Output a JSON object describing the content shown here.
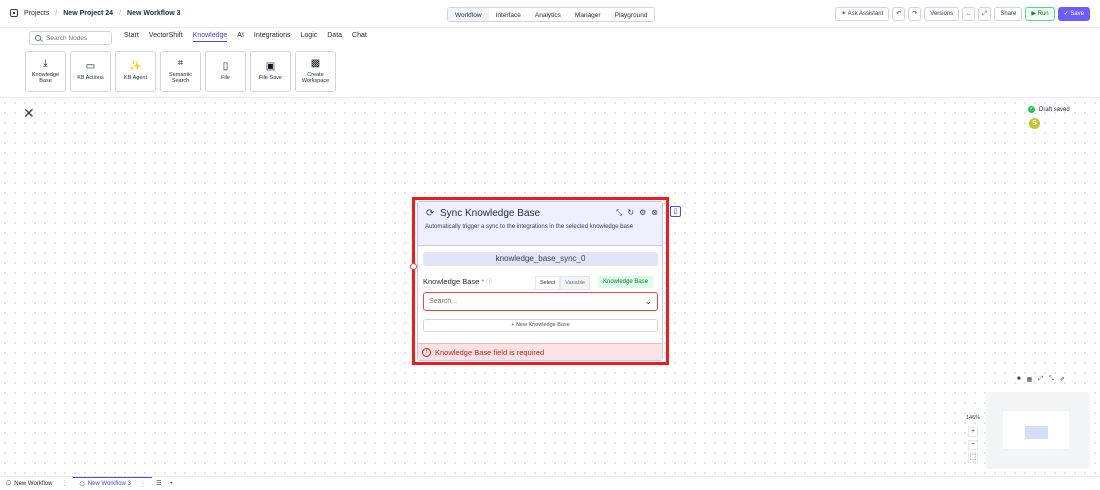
{
  "topbar": {
    "breadcrumbs": [
      "Projects",
      "New Project 24",
      "New Workflow 3"
    ],
    "tabs": [
      {
        "label": "Workflow",
        "active": true
      },
      {
        "label": "Interface",
        "active": false
      },
      {
        "label": "Analytics",
        "active": false
      },
      {
        "label": "Manager",
        "active": false
      },
      {
        "label": "Playground",
        "active": false
      }
    ],
    "ask_assistant": "✶ Ask Assistant",
    "undo": "↶",
    "redo": "↷",
    "versions": "Versions",
    "split": "↔",
    "expand": "⤢",
    "share": "Share",
    "run": "▶ Run",
    "save": "✓ Save"
  },
  "toolbar": {
    "search_placeholder": "Search Nodes",
    "categories": [
      "Start",
      "VectorShift",
      "Knowledge",
      "AI",
      "Integrations",
      "Logic",
      "Data",
      "Chat"
    ],
    "active_category": "Knowledge",
    "nodes": [
      {
        "label": "Knowledge Base",
        "icon": "download-icon",
        "glyph": "⤓"
      },
      {
        "label": "KB Actions",
        "icon": "folder-icon",
        "glyph": "▭"
      },
      {
        "label": "KB Agent",
        "icon": "magic-wand-icon",
        "glyph": "✨"
      },
      {
        "label": "Semantic Search",
        "icon": "crop-icon",
        "glyph": "⌗"
      },
      {
        "label": "File",
        "icon": "file-icon",
        "glyph": "▯"
      },
      {
        "label": "File Save",
        "icon": "floppy-icon",
        "glyph": "▣"
      },
      {
        "label": "Create Workspace",
        "icon": "folder-plus-icon",
        "glyph": "▩"
      }
    ]
  },
  "canvas": {
    "close": "✕",
    "draft_status": "Draft saved",
    "avatar_initial": "S",
    "zoom": "146%",
    "zoom_in": "+",
    "zoom_out": "−",
    "fit": "⬚",
    "minimap_tools": [
      "■",
      "▦",
      "⤢",
      "⤡",
      "✐"
    ]
  },
  "node": {
    "title": "Sync Knowledge Base",
    "description": "Automatically trigger a sync to the integrations in the selected knowledge base",
    "name": "knowledge_base_sync_0",
    "field_label": "Knowledge Base",
    "required_mark": "*",
    "info_glyph": "ⓘ",
    "mode_select": "Select",
    "mode_variable": "Variable",
    "type_badge": "Knowledge Base",
    "select_placeholder": "Search...",
    "new_button": "+ New Knowledge Base",
    "error": "Knowledge Base field is required",
    "header_icons": [
      "⤡",
      "↻",
      "⚙",
      "⊗"
    ]
  },
  "bottombar": {
    "tabs": [
      {
        "label": "New Workflow",
        "active": false
      },
      {
        "label": "New Workflow 3",
        "active": true
      }
    ],
    "list_icon": "☰",
    "add_icon": "+"
  }
}
